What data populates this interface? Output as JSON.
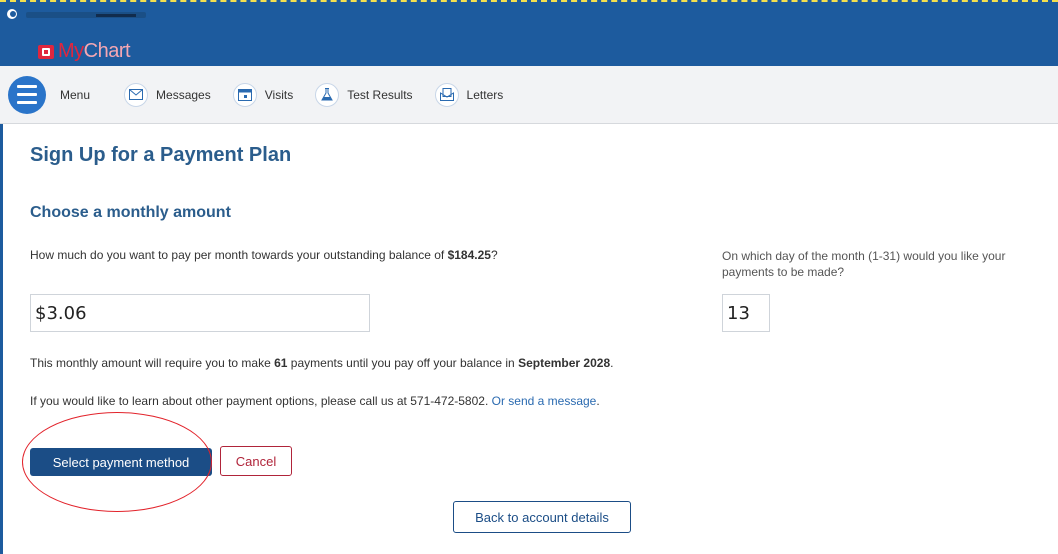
{
  "header": {
    "app_name_prefix": "My",
    "app_name_suffix": "Chart"
  },
  "nav": {
    "menu_label": "Menu",
    "items": [
      {
        "label": "Messages",
        "icon": "envelope-icon"
      },
      {
        "label": "Visits",
        "icon": "calendar-icon"
      },
      {
        "label": "Test Results",
        "icon": "flask-icon"
      },
      {
        "label": "Letters",
        "icon": "letter-icon"
      }
    ]
  },
  "page": {
    "title_part1": "Sign Up for ",
    "title_stray_char": "a",
    "title_part2": " Payment Plan",
    "section_title": "Choose a monthly amount"
  },
  "form": {
    "amount_question_prefix": "How much do you want to pay per month towards your outstanding balance of ",
    "balance": "$184.25",
    "amount_question_suffix": "?",
    "day_question": "On which day of the month (1-31) would you like your payments to be made?",
    "amount_value": "$3.06",
    "day_value": "13"
  },
  "info": {
    "line1_prefix": "This monthly amount will require you to make ",
    "payments_count": "61",
    "line1_middle": " payments until you pay off your balance in ",
    "payoff_date": "September 2028",
    "line1_suffix": ".",
    "line2_prefix": "If you would like to learn about other payment options, please call us at 571-472-5802. ",
    "line2_link": "Or send a message",
    "line2_suffix": "."
  },
  "buttons": {
    "select_payment": "Select payment method",
    "cancel": "Cancel",
    "back": "Back to account details"
  },
  "colors": {
    "brand_blue": "#1d5b9e",
    "primary_button": "#1b4d86",
    "cancel_red": "#b0243a",
    "annotation_red": "#e2232b"
  }
}
